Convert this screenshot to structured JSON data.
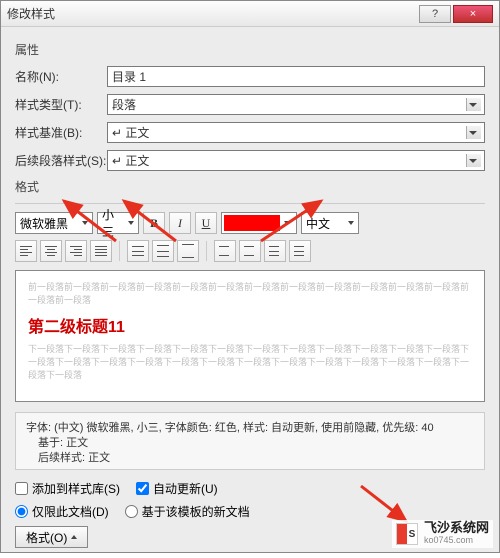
{
  "titlebar": {
    "title": "修改样式",
    "help": "?",
    "close": "×"
  },
  "labels": {
    "properties": "属性",
    "name": "名称(N):",
    "type": "样式类型(T):",
    "based": "样式基准(B):",
    "follow": "后续段落样式(S):",
    "format": "格式"
  },
  "fields": {
    "name": "目录 1",
    "type": "段落",
    "based": "↵ 正文",
    "follow": "↵ 正文"
  },
  "format": {
    "font": "微软雅黑",
    "size": "小三",
    "bold": "B",
    "italic": "I",
    "underline": "U",
    "color": "#ff0000",
    "lang": "中文"
  },
  "preview": {
    "before": "前一段落前一段落前一段落前一段落前一段落前一段落前一段落前一段落前一段落前一段落前一段落前一段落前一段落前一段落",
    "sample": "第二级标题11",
    "after": "下一段落下一段落下一段落下一段落下一段落下一段落下一段落下一段落下一段落下一段落下一段落下一段落下一段落下一段落下一段落下一段落下一段落下一段落下一段落下一段落下一段落下一段落下一段落下一段落下一段落下一段落"
  },
  "desc": {
    "line1": "字体: (中文) 微软雅黑, 小三, 字体颜色: 红色, 样式: 自动更新, 使用前隐藏, 优先级: 40",
    "line2": "基于: 正文",
    "line3": "后续样式: 正文"
  },
  "bottom": {
    "addToList": "添加到样式库(S)",
    "autoUpdate": "自动更新(U)",
    "thisDoc": "仅限此文档(D)",
    "newDocs": "基于该模板的新文档",
    "formatBtn": "格式(O)"
  },
  "watermark": {
    "brand": "飞沙系统网",
    "url": "ko0745.com"
  }
}
